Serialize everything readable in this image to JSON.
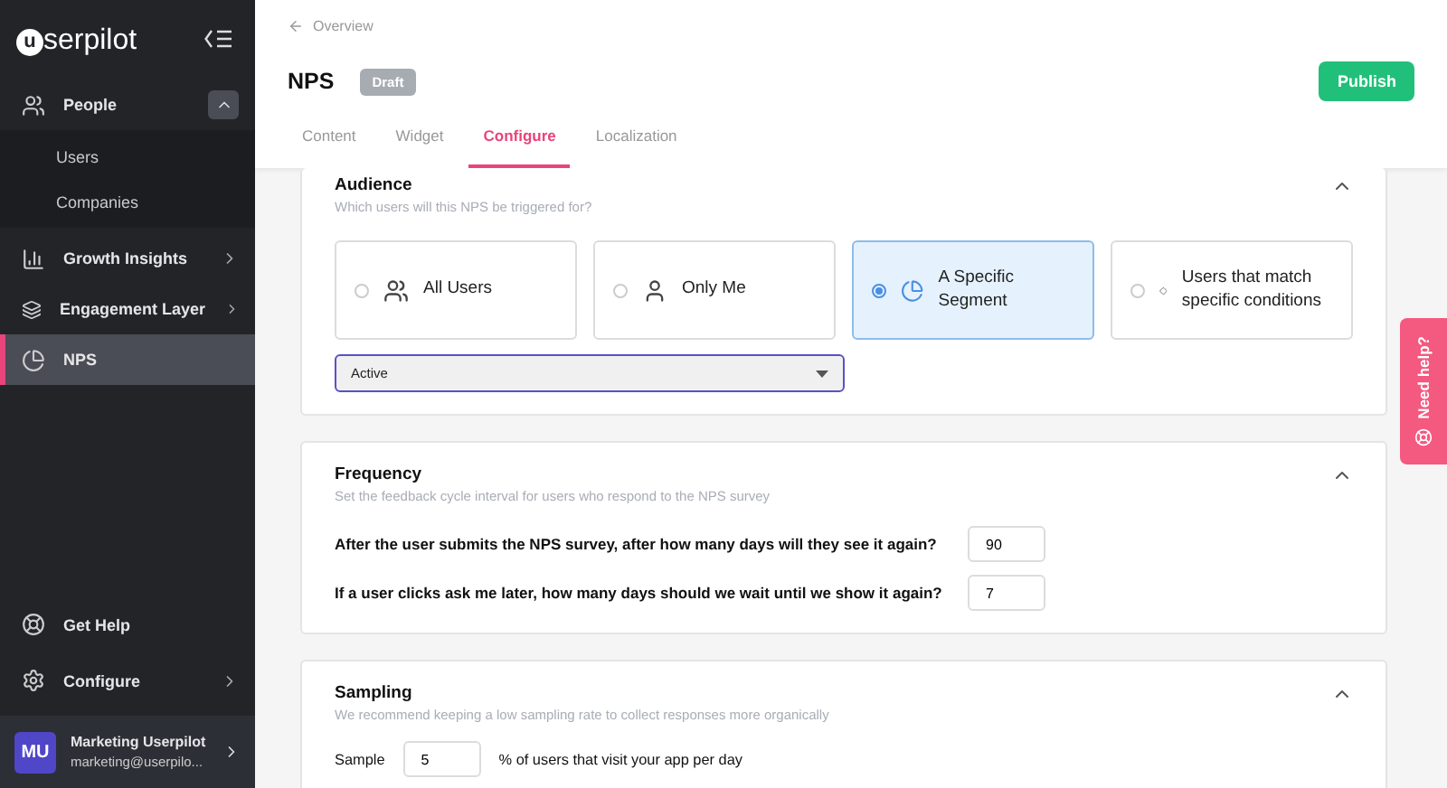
{
  "sidebar": {
    "logo": {
      "mark": "u",
      "text": "serpilot"
    },
    "items": [
      {
        "label": "People",
        "selected": false,
        "expanded": true,
        "children": [
          {
            "label": "Users",
            "selected": false
          },
          {
            "label": "Companies",
            "selected": false
          }
        ]
      },
      {
        "label": "Growth Insights",
        "selected": false,
        "has_arrow": true
      },
      {
        "label": "Engagement Layer",
        "selected": false,
        "has_arrow": true
      },
      {
        "label": "NPS",
        "selected": true,
        "has_arrow": false
      }
    ],
    "bottom_items": [
      {
        "label": "Get Help",
        "has_arrow": false
      },
      {
        "label": "Configure",
        "has_arrow": true
      }
    ],
    "account": {
      "initials": "MU",
      "name": "Marketing Userpilot",
      "email": "marketing@userpilo..."
    }
  },
  "header": {
    "back": "Overview",
    "title": "NPS",
    "status": "Draft",
    "publish": "Publish",
    "tabs": [
      {
        "label": "Content",
        "selected": false
      },
      {
        "label": "Widget",
        "selected": false
      },
      {
        "label": "Configure",
        "selected": true
      },
      {
        "label": "Localization",
        "selected": false
      }
    ]
  },
  "audience": {
    "title": "Audience",
    "subtitle": "Which users will this NPS be triggered for?",
    "options": [
      {
        "label": "All Users",
        "selected": false
      },
      {
        "label": "Only Me",
        "selected": false
      },
      {
        "label": "A Specific Segment",
        "selected": true
      },
      {
        "label": "Users that match specific conditions",
        "selected": false
      }
    ],
    "segment": "Active"
  },
  "frequency": {
    "title": "Frequency",
    "subtitle": "Set the feedback cycle interval for users who respond to the NPS survey",
    "questions": [
      {
        "label": "After the user submits the NPS survey, after how many days will they see it again?",
        "value": "90"
      },
      {
        "label": "If a user clicks ask me later, how many days should we wait until we show it again?",
        "value": "7"
      }
    ]
  },
  "sampling": {
    "title": "Sampling",
    "subtitle": "We recommend keeping a low sampling rate to collect responses more organically",
    "prefix": "Sample",
    "value": "5",
    "suffix": "% of users that visit your app per day"
  },
  "help_tab": "Need help?"
}
